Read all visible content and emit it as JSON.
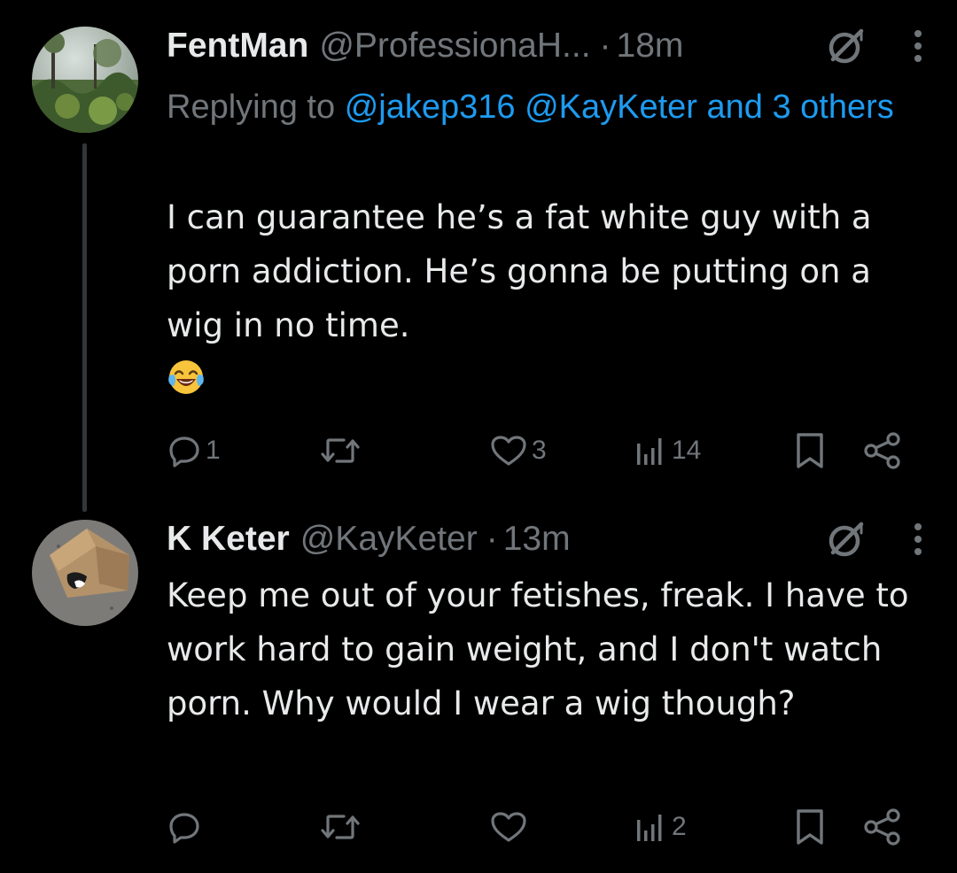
{
  "colors": {
    "background": "#000000",
    "text_primary": "#e7e9ea",
    "text_secondary": "#71767b",
    "link": "#1d9bf0",
    "thread_line": "#333639"
  },
  "tweets": [
    {
      "display_name": "FentMan",
      "handle": "@ProfessionaH...",
      "separator": "·",
      "time": "18m",
      "replying_prefix": "Replying to",
      "replying_mentions": "@jakep316 @KayKeter and 3 others",
      "body": "I can guarantee he’s a fat white guy with a porn addiction. He’s gonna be putting on a wig in no time.",
      "emoji": "face-with-tears-of-joy",
      "counts": {
        "replies": "1",
        "retweets": "",
        "likes": "3",
        "views": "14"
      },
      "avatar": "forest-photo"
    },
    {
      "display_name": "K Keter",
      "handle": "@KayKeter",
      "separator": "·",
      "time": "13m",
      "body": "Keep me out of your fetishes, freak. I have to work hard to gain weight, and I don't watch porn. Why would I wear a wig though?",
      "counts": {
        "replies": "",
        "retweets": "",
        "likes": "",
        "views": "2"
      },
      "avatar": "cat-in-box-photo"
    }
  ]
}
